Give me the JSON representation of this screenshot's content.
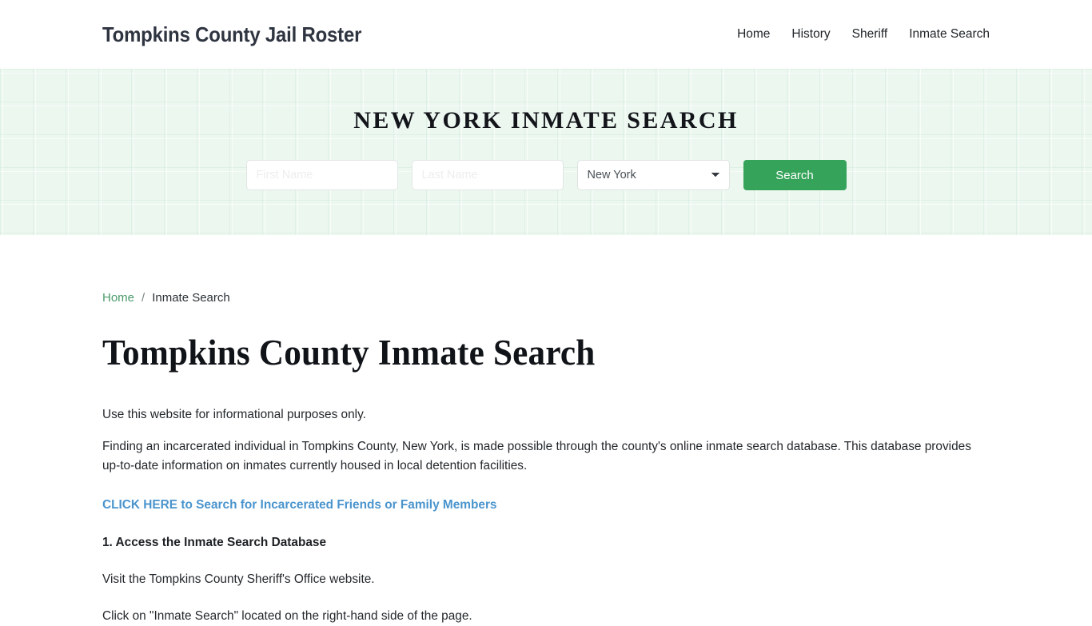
{
  "header": {
    "brand": "Tompkins County Jail Roster",
    "nav": [
      {
        "label": "Home"
      },
      {
        "label": "History"
      },
      {
        "label": "Sheriff"
      },
      {
        "label": "Inmate Search"
      }
    ]
  },
  "hero": {
    "title": "NEW YORK INMATE SEARCH",
    "background_color": "#ecf7f0",
    "form": {
      "first_name_value": "",
      "first_name_placeholder": "First Name",
      "last_name_value": "",
      "last_name_placeholder": "Last Name",
      "state_selected": "New York",
      "state_options": [
        "New York"
      ],
      "search_label": "Search",
      "search_button_color": "#35a35a"
    }
  },
  "breadcrumb": {
    "home_label": "Home",
    "separator": "/",
    "current_label": "Inmate Search",
    "link_color": "#4c9a6a"
  },
  "main": {
    "page_title": "Tompkins County Inmate Search",
    "intro": "Use this website for informational purposes only.",
    "description": "Finding an incarcerated individual in Tompkins County, New York, is made possible through the county's online inmate search database. This database provides up-to-date information on inmates currently housed in local detention facilities.",
    "cta_link": "CLICK HERE to Search for Incarcerated Friends or Family Members",
    "cta_color": "#4a94cd",
    "step_1_heading": "1. Access the Inmate Search Database",
    "step_1_line_1": "Visit the Tompkins County Sheriff's Office website.",
    "step_1_line_2": "Click on \"Inmate Search\" located on the right-hand side of the page."
  }
}
